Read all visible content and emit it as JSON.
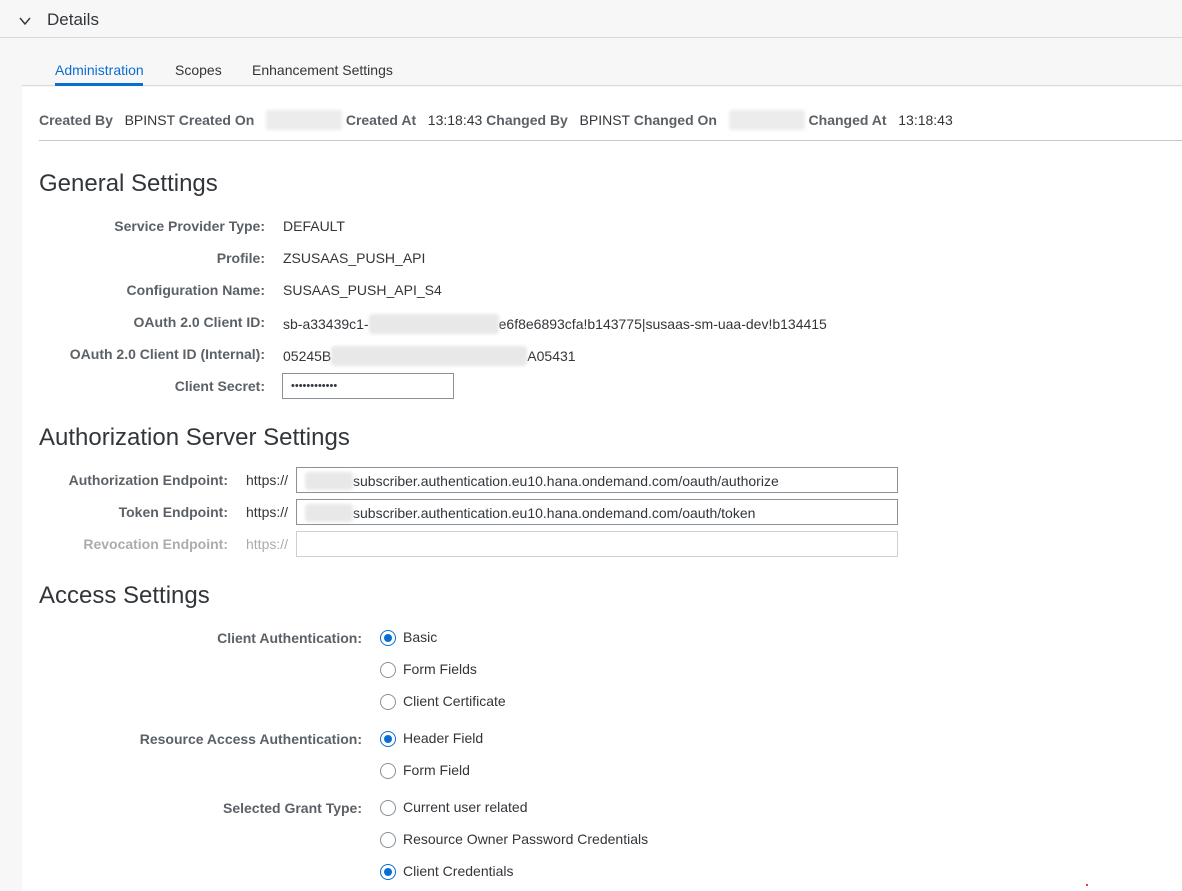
{
  "header": {
    "title": "Details",
    "toggle_icon": "chevron-down-icon"
  },
  "tabs": [
    {
      "label": "Administration",
      "active": true
    },
    {
      "label": "Scopes",
      "active": false
    },
    {
      "label": "Enhancement Settings",
      "active": false
    }
  ],
  "admin": {
    "created_by_label": "Created By",
    "created_by": "BPINST",
    "created_on_label": "Created On",
    "created_at_label": "Created At",
    "created_at": "13:18:43",
    "changed_by_label": "Changed By",
    "changed_by": "BPINST",
    "changed_on_label": "Changed On",
    "changed_at_label": "Changed At",
    "changed_at": "13:18:43"
  },
  "general": {
    "title": "General Settings",
    "service_provider_type_label": "Service Provider Type:",
    "service_provider_type": "DEFAULT",
    "profile_label": "Profile:",
    "profile": "ZSUSAAS_PUSH_API",
    "configuration_name_label": "Configuration Name:",
    "configuration_name": "SUSAAS_PUSH_API_S4",
    "client_id_label": "OAuth 2.0 Client ID:",
    "client_id_start": "sb-a33439c1-",
    "client_id_end": "e6f8e6893cfa!b143775|susaas-sm-uaa-dev!b134415",
    "client_id_internal_label": "OAuth 2.0 Client ID (Internal):",
    "client_id_internal_start": "05245B",
    "client_id_internal_end": "A05431",
    "client_secret_label": "Client Secret:",
    "client_secret": "••••••••••••"
  },
  "auth_server": {
    "title": "Authorization Server Settings",
    "authorization_endpoint_label": "Authorization Endpoint:",
    "authorization_endpoint_prefix": "https://",
    "authorization_endpoint": "subscriber.authentication.eu10.hana.ondemand.com/oauth/authorize",
    "token_endpoint_label": "Token Endpoint:",
    "token_endpoint_prefix": "https://",
    "token_endpoint": "subscriber.authentication.eu10.hana.ondemand.com/oauth/token",
    "revocation_endpoint_label": "Revocation Endpoint:",
    "revocation_endpoint_prefix": "https://",
    "revocation_endpoint": ""
  },
  "access": {
    "title": "Access Settings",
    "client_auth_label": "Client Authentication:",
    "client_auth_options": [
      {
        "label": "Basic",
        "checked": true
      },
      {
        "label": "Form Fields",
        "checked": false
      },
      {
        "label": "Client Certificate",
        "checked": false
      }
    ],
    "resource_auth_label": "Resource Access Authentication:",
    "resource_auth_options": [
      {
        "label": "Header Field",
        "checked": true
      },
      {
        "label": "Form Field",
        "checked": false
      }
    ],
    "grant_type_label": "Selected Grant Type:",
    "grant_type_options": [
      {
        "label": "Current user related",
        "checked": false
      },
      {
        "label": "Resource Owner Password Credentials",
        "checked": false
      },
      {
        "label": "Client Credentials",
        "checked": true
      }
    ]
  },
  "colors": {
    "accent": "#0a6ed1",
    "label": "#5b6166",
    "text": "#32363a",
    "background": "#f7f7f7"
  }
}
